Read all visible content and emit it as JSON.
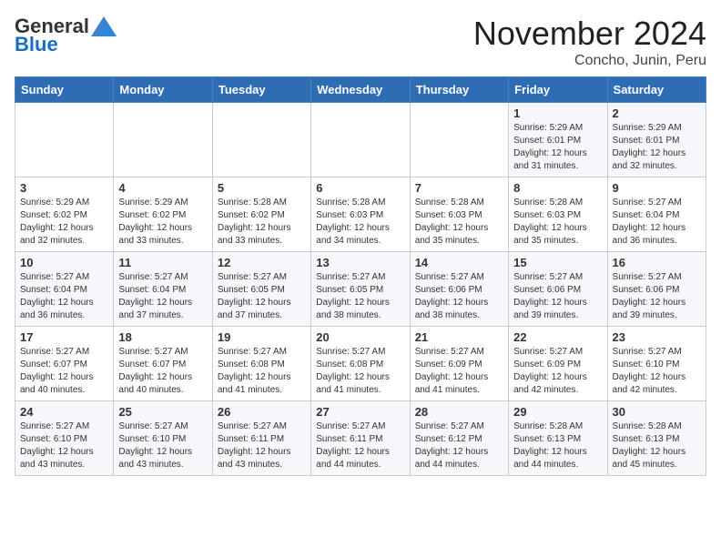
{
  "header": {
    "logo_general": "General",
    "logo_blue": "Blue",
    "month_title": "November 2024",
    "subtitle": "Concho, Junin, Peru"
  },
  "days_of_week": [
    "Sunday",
    "Monday",
    "Tuesday",
    "Wednesday",
    "Thursday",
    "Friday",
    "Saturday"
  ],
  "weeks": [
    [
      {
        "day": "",
        "info": ""
      },
      {
        "day": "",
        "info": ""
      },
      {
        "day": "",
        "info": ""
      },
      {
        "day": "",
        "info": ""
      },
      {
        "day": "",
        "info": ""
      },
      {
        "day": "1",
        "info": "Sunrise: 5:29 AM\nSunset: 6:01 PM\nDaylight: 12 hours\nand 31 minutes."
      },
      {
        "day": "2",
        "info": "Sunrise: 5:29 AM\nSunset: 6:01 PM\nDaylight: 12 hours\nand 32 minutes."
      }
    ],
    [
      {
        "day": "3",
        "info": "Sunrise: 5:29 AM\nSunset: 6:02 PM\nDaylight: 12 hours\nand 32 minutes."
      },
      {
        "day": "4",
        "info": "Sunrise: 5:29 AM\nSunset: 6:02 PM\nDaylight: 12 hours\nand 33 minutes."
      },
      {
        "day": "5",
        "info": "Sunrise: 5:28 AM\nSunset: 6:02 PM\nDaylight: 12 hours\nand 33 minutes."
      },
      {
        "day": "6",
        "info": "Sunrise: 5:28 AM\nSunset: 6:03 PM\nDaylight: 12 hours\nand 34 minutes."
      },
      {
        "day": "7",
        "info": "Sunrise: 5:28 AM\nSunset: 6:03 PM\nDaylight: 12 hours\nand 35 minutes."
      },
      {
        "day": "8",
        "info": "Sunrise: 5:28 AM\nSunset: 6:03 PM\nDaylight: 12 hours\nand 35 minutes."
      },
      {
        "day": "9",
        "info": "Sunrise: 5:27 AM\nSunset: 6:04 PM\nDaylight: 12 hours\nand 36 minutes."
      }
    ],
    [
      {
        "day": "10",
        "info": "Sunrise: 5:27 AM\nSunset: 6:04 PM\nDaylight: 12 hours\nand 36 minutes."
      },
      {
        "day": "11",
        "info": "Sunrise: 5:27 AM\nSunset: 6:04 PM\nDaylight: 12 hours\nand 37 minutes."
      },
      {
        "day": "12",
        "info": "Sunrise: 5:27 AM\nSunset: 6:05 PM\nDaylight: 12 hours\nand 37 minutes."
      },
      {
        "day": "13",
        "info": "Sunrise: 5:27 AM\nSunset: 6:05 PM\nDaylight: 12 hours\nand 38 minutes."
      },
      {
        "day": "14",
        "info": "Sunrise: 5:27 AM\nSunset: 6:06 PM\nDaylight: 12 hours\nand 38 minutes."
      },
      {
        "day": "15",
        "info": "Sunrise: 5:27 AM\nSunset: 6:06 PM\nDaylight: 12 hours\nand 39 minutes."
      },
      {
        "day": "16",
        "info": "Sunrise: 5:27 AM\nSunset: 6:06 PM\nDaylight: 12 hours\nand 39 minutes."
      }
    ],
    [
      {
        "day": "17",
        "info": "Sunrise: 5:27 AM\nSunset: 6:07 PM\nDaylight: 12 hours\nand 40 minutes."
      },
      {
        "day": "18",
        "info": "Sunrise: 5:27 AM\nSunset: 6:07 PM\nDaylight: 12 hours\nand 40 minutes."
      },
      {
        "day": "19",
        "info": "Sunrise: 5:27 AM\nSunset: 6:08 PM\nDaylight: 12 hours\nand 41 minutes."
      },
      {
        "day": "20",
        "info": "Sunrise: 5:27 AM\nSunset: 6:08 PM\nDaylight: 12 hours\nand 41 minutes."
      },
      {
        "day": "21",
        "info": "Sunrise: 5:27 AM\nSunset: 6:09 PM\nDaylight: 12 hours\nand 41 minutes."
      },
      {
        "day": "22",
        "info": "Sunrise: 5:27 AM\nSunset: 6:09 PM\nDaylight: 12 hours\nand 42 minutes."
      },
      {
        "day": "23",
        "info": "Sunrise: 5:27 AM\nSunset: 6:10 PM\nDaylight: 12 hours\nand 42 minutes."
      }
    ],
    [
      {
        "day": "24",
        "info": "Sunrise: 5:27 AM\nSunset: 6:10 PM\nDaylight: 12 hours\nand 43 minutes."
      },
      {
        "day": "25",
        "info": "Sunrise: 5:27 AM\nSunset: 6:10 PM\nDaylight: 12 hours\nand 43 minutes."
      },
      {
        "day": "26",
        "info": "Sunrise: 5:27 AM\nSunset: 6:11 PM\nDaylight: 12 hours\nand 43 minutes."
      },
      {
        "day": "27",
        "info": "Sunrise: 5:27 AM\nSunset: 6:11 PM\nDaylight: 12 hours\nand 44 minutes."
      },
      {
        "day": "28",
        "info": "Sunrise: 5:27 AM\nSunset: 6:12 PM\nDaylight: 12 hours\nand 44 minutes."
      },
      {
        "day": "29",
        "info": "Sunrise: 5:28 AM\nSunset: 6:13 PM\nDaylight: 12 hours\nand 44 minutes."
      },
      {
        "day": "30",
        "info": "Sunrise: 5:28 AM\nSunset: 6:13 PM\nDaylight: 12 hours\nand 45 minutes."
      }
    ]
  ]
}
